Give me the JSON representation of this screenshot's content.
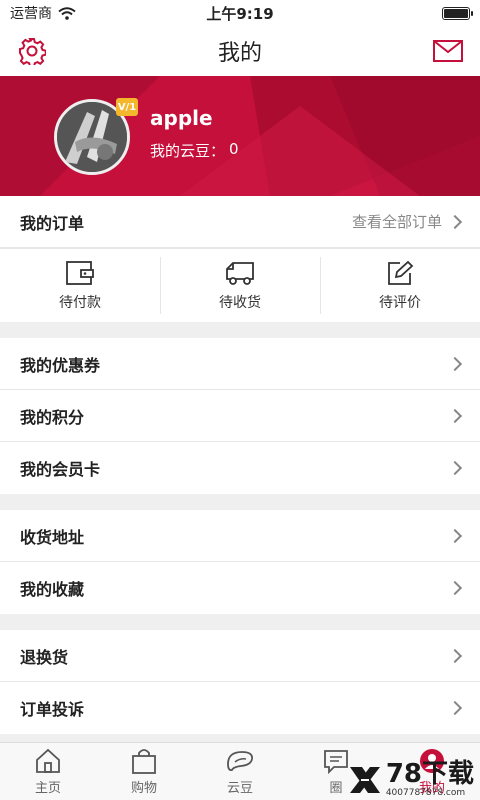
{
  "status_bar": {
    "carrier": "运营商",
    "time": "上午9:19",
    "battery_level": 1.0
  },
  "nav": {
    "title": "我的"
  },
  "profile": {
    "username": "apple",
    "beans_label": "我的云豆：",
    "beans_value": "0",
    "vip_badge": "V/1"
  },
  "orders": {
    "title": "我的订单",
    "view_all": "查看全部订单",
    "tabs": [
      {
        "label": "待付款",
        "icon": "wallet-icon"
      },
      {
        "label": "待收货",
        "icon": "truck-icon"
      },
      {
        "label": "待评价",
        "icon": "edit-icon"
      }
    ]
  },
  "group1": [
    {
      "label": "我的优惠券"
    },
    {
      "label": "我的积分"
    },
    {
      "label": "我的会员卡"
    }
  ],
  "group2": [
    {
      "label": "收货地址"
    },
    {
      "label": "我的收藏"
    }
  ],
  "group3": [
    {
      "label": "退换货"
    },
    {
      "label": "订单投诉"
    }
  ],
  "tab_bar": [
    {
      "label": "主页",
      "icon": "home-icon"
    },
    {
      "label": "购物",
      "icon": "shopping-bag-icon"
    },
    {
      "label": "云豆",
      "icon": "bean-icon"
    },
    {
      "label": "圈",
      "icon": "message-icon"
    },
    {
      "label": "我的",
      "icon": "user-icon",
      "active": true
    }
  ],
  "watermark": {
    "brand": "78下载",
    "phone": "4007787878.com"
  },
  "colors": {
    "accent": "#c4103b",
    "background": "#efefef"
  }
}
